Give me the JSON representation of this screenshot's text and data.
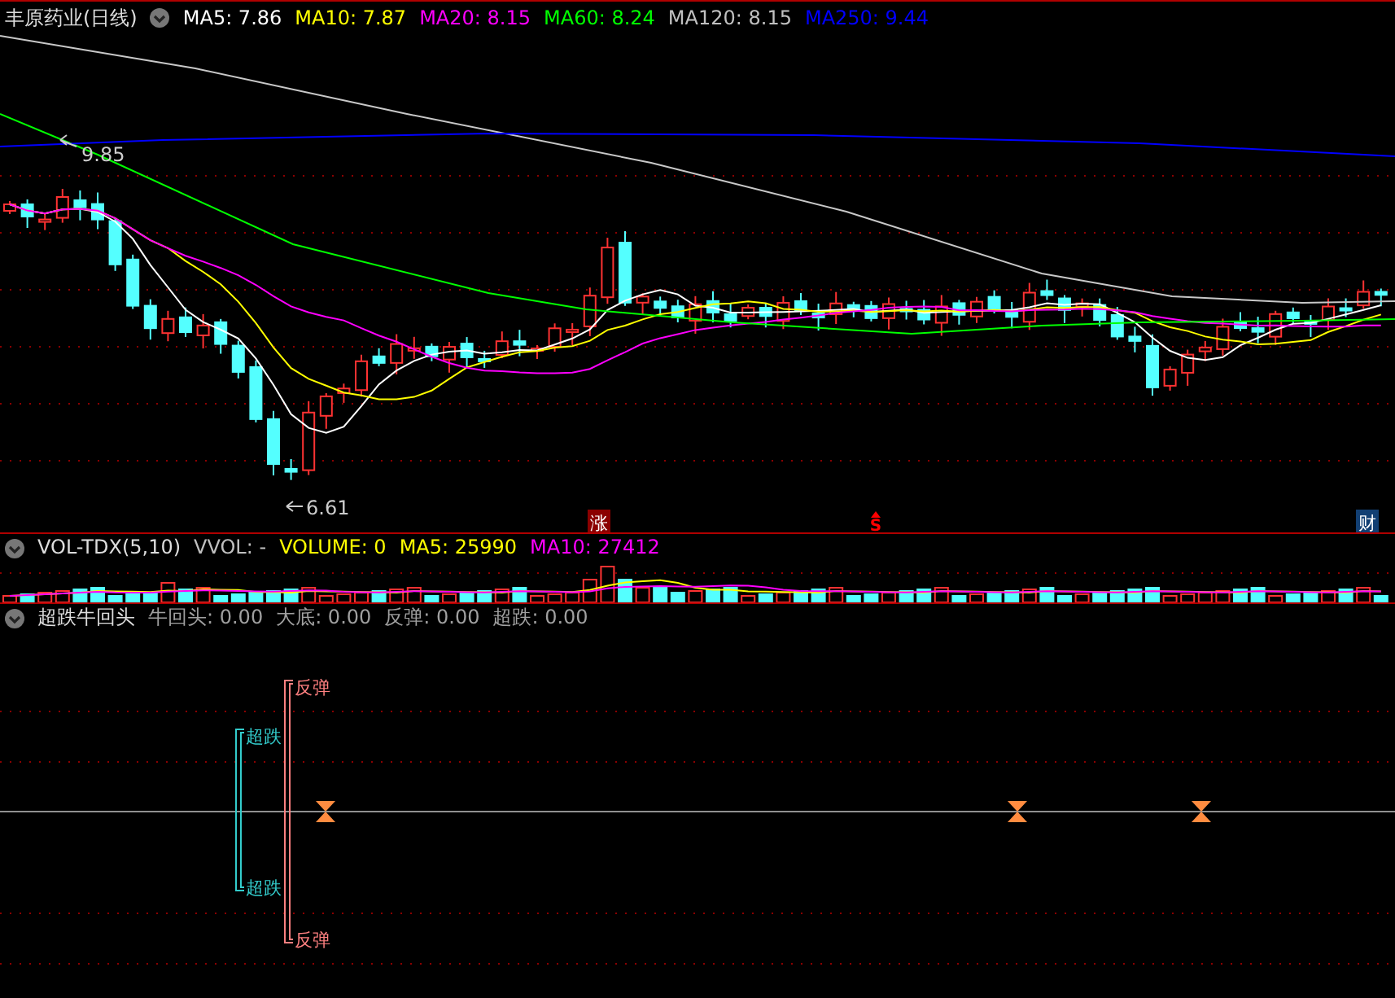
{
  "main_header": {
    "title": "丰原药业(日线)",
    "legend": [
      {
        "label": "MA5: 7.86",
        "color": "#ffffff"
      },
      {
        "label": "MA10: 7.87",
        "color": "#ffff00"
      },
      {
        "label": "MA20: 8.15",
        "color": "#ff00ff"
      },
      {
        "label": "MA60: 8.24",
        "color": "#00ff00"
      },
      {
        "label": "MA120: 8.15",
        "color": "#c0c0c0"
      },
      {
        "label": "MA250: 9.44",
        "color": "#0000ff"
      }
    ]
  },
  "main_chart": {
    "high_label": "9.85",
    "low_label": "6.61",
    "markers": [
      {
        "kind": "box",
        "label": "涨",
        "color": "#8b0000"
      },
      {
        "kind": "arrow",
        "label": "S",
        "color": "#ff0000"
      },
      {
        "kind": "box",
        "label": "财",
        "color": "#123f73"
      }
    ]
  },
  "volume_header": {
    "title": "VOL-TDX(5,10)",
    "legend": [
      {
        "label": "VVOL: -",
        "color": "#c0c0c0"
      },
      {
        "label": "VOLUME: 0",
        "color": "#ffff00"
      },
      {
        "label": "MA5: 25990",
        "color": "#ffff00"
      },
      {
        "label": "MA10: 27412",
        "color": "#ff00ff"
      }
    ]
  },
  "indicator_header": {
    "title": "超跌牛回头",
    "legend": [
      {
        "label": "牛回头: 0.00",
        "color": "#a0a0a0"
      },
      {
        "label": "大底: 0.00",
        "color": "#a0a0a0"
      },
      {
        "label": "反弹: 0.00",
        "color": "#a0a0a0"
      },
      {
        "label": "超跌: 0.00",
        "color": "#a0a0a0"
      }
    ]
  },
  "indicator_chart": {
    "signals": [
      {
        "kind": "upper",
        "label": "超跌",
        "color": "#33cccc"
      },
      {
        "kind": "lower",
        "label": "超跌",
        "color": "#33cccc"
      },
      {
        "kind": "upper",
        "label": "反弹",
        "color": "#ff8080"
      },
      {
        "kind": "lower",
        "label": "反弹",
        "color": "#ff8080"
      }
    ]
  }
}
